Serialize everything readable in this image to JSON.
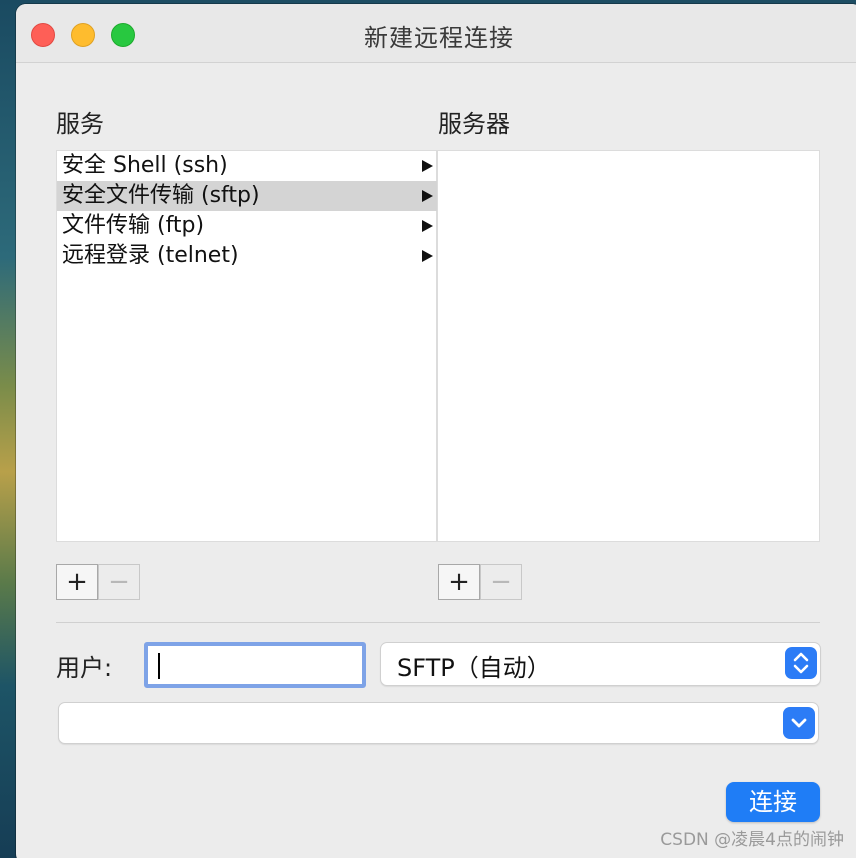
{
  "window": {
    "title": "新建远程连接"
  },
  "services": {
    "label": "服务",
    "items": [
      {
        "label": "安全 Shell (ssh)",
        "selected": false
      },
      {
        "label": "安全文件传输 (sftp)",
        "selected": true
      },
      {
        "label": "文件传输 (ftp)",
        "selected": false
      },
      {
        "label": "远程登录 (telnet)",
        "selected": false
      }
    ]
  },
  "servers": {
    "label": "服务器",
    "items": []
  },
  "buttons": {
    "add_label": "+",
    "remove_label": "−",
    "connect_label": "连接"
  },
  "user": {
    "label": "用户:",
    "value": ""
  },
  "protocol_select": {
    "selected": "SFTP（自动）"
  },
  "server_combo": {
    "value": ""
  },
  "watermark": "CSDN @凌晨4点的闹钟",
  "colors": {
    "accent": "#1f7df6",
    "focus_ring": "#7ea3e7",
    "selection": "#d4d4d4",
    "close": "#fe5f57",
    "minimize": "#febc2e",
    "zoom": "#28c840"
  },
  "icons": {
    "row_arrow": "triangle-right-icon",
    "stepper": "chevron-up-down-icon",
    "dropdown": "chevron-down-icon"
  }
}
